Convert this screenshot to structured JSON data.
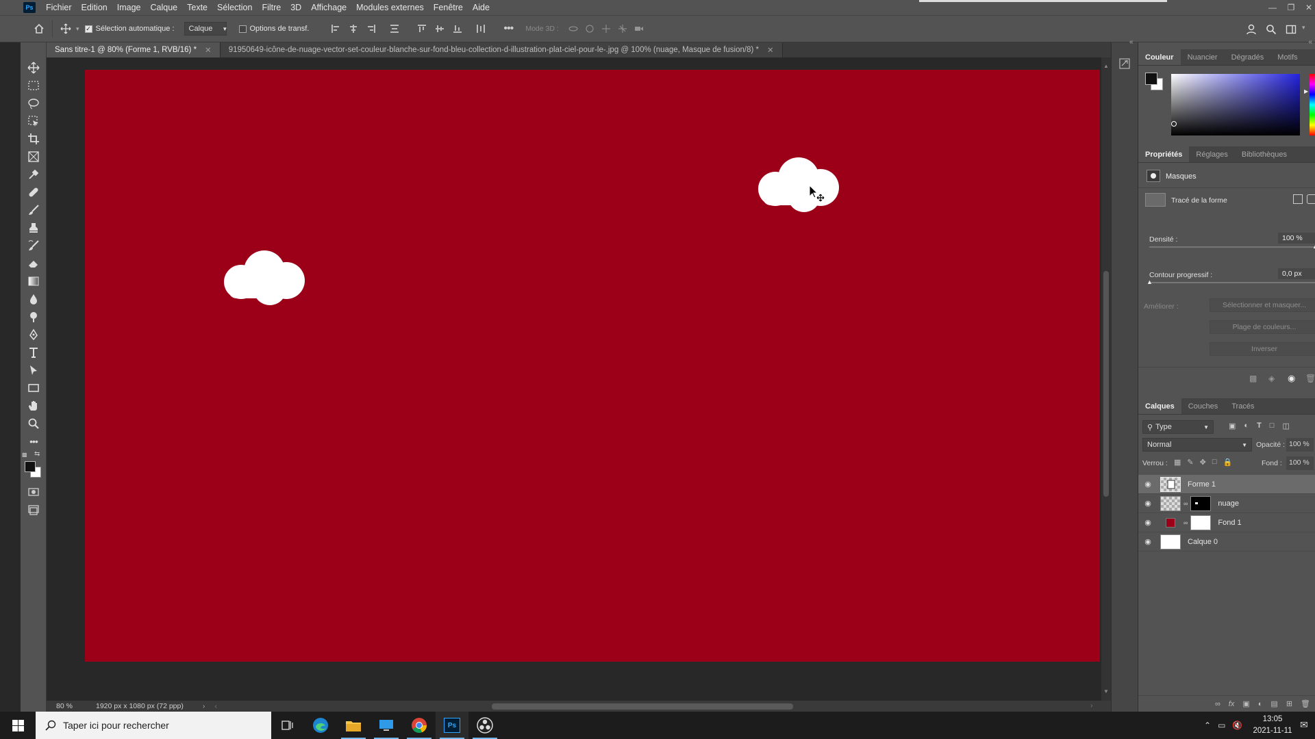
{
  "menubar": {
    "logo": "Ps",
    "items": [
      "Fichier",
      "Edition",
      "Image",
      "Calque",
      "Texte",
      "Sélection",
      "Filtre",
      "3D",
      "Affichage",
      "Modules externes",
      "Fenêtre",
      "Aide"
    ]
  },
  "options": {
    "auto_select_label": "Sélection automatique :",
    "auto_select_value": "Calque",
    "transform_label": "Options de transf.",
    "mode3d_label": "Mode 3D :"
  },
  "tabs": [
    {
      "label": "Sans titre-1 @ 80% (Forme 1, RVB/16) *",
      "active": true
    },
    {
      "label": "91950649-icône-de-nuage-vector-set-couleur-blanche-sur-fond-bleu-collection-d-illustration-plat-ciel-pour-le-.jpg @ 100% (nuage, Masque de fusion/8) *",
      "active": false
    }
  ],
  "canvas": {
    "background": "#9b0018"
  },
  "status": {
    "zoom": "80 %",
    "doc_size": "1920 px x 1080 px (72 ppp)"
  },
  "color_panel": {
    "tabs": [
      "Couleur",
      "Nuancier",
      "Dégradés",
      "Motifs"
    ]
  },
  "properties": {
    "tabs": [
      "Propriétés",
      "Réglages",
      "Bibliothèques"
    ],
    "section": "Masques",
    "shape_path": "Tracé de la forme",
    "density_label": "Densité :",
    "density_value": "100 %",
    "feather_label": "Contour progressif :",
    "feather_value": "0,0 px",
    "refine_label": "Améliorer :",
    "select_mask_btn": "Sélectionner et masquer...",
    "color_range_btn": "Plage de couleurs...",
    "invert_btn": "Inverser"
  },
  "layers_panel": {
    "tabs": [
      "Calques",
      "Couches",
      "Tracés"
    ],
    "filter": "Type",
    "blend_mode": "Normal",
    "opacity_label": "Opacité :",
    "opacity_value": "100 %",
    "lock_label": "Verrou :",
    "fill_label": "Fond :",
    "fill_value": "100 %",
    "layers": [
      {
        "name": "Forme 1",
        "selected": true
      },
      {
        "name": "nuage",
        "selected": false
      },
      {
        "name": "Fond 1",
        "selected": false
      },
      {
        "name": "Calque 0",
        "selected": false
      }
    ]
  },
  "taskbar": {
    "search_placeholder": "Taper ici pour rechercher",
    "time": "13:05",
    "date": "2021-11-11"
  }
}
